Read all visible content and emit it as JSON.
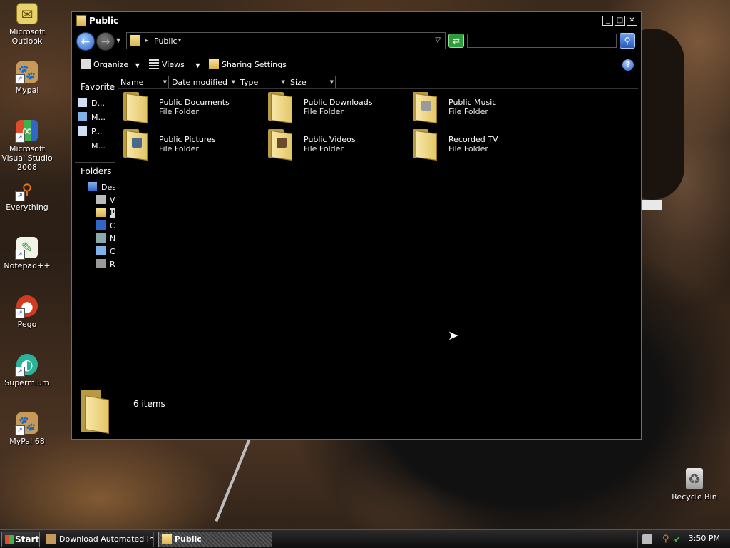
{
  "desktop": {
    "icons": [
      {
        "label": "Microsoft Outlook",
        "icon": "outlook-icon"
      },
      {
        "label": "Mypal",
        "icon": "mypal-icon"
      },
      {
        "label": "Microsoft Visual Studio 2008",
        "icon": "visual-studio-icon"
      },
      {
        "label": "Everything",
        "icon": "everything-icon"
      },
      {
        "label": "Notepad++",
        "icon": "notepadpp-icon"
      },
      {
        "label": "Pego",
        "icon": "pego-icon"
      },
      {
        "label": "Supermium",
        "icon": "supermium-icon"
      },
      {
        "label": "MyPal 68",
        "icon": "mypal-icon"
      }
    ],
    "recycle_bin": {
      "label": "Recycle Bin",
      "icon": "recycle-bin-icon"
    }
  },
  "window": {
    "title": "Public",
    "controls": {
      "minimize": "_",
      "maximize": "□",
      "close": "✕"
    },
    "address": {
      "path": "Public"
    },
    "search": {
      "placeholder": ""
    },
    "toolbar": {
      "organize": "Organize",
      "views": "Views",
      "sharing": "Sharing Settings"
    },
    "left_pane": {
      "favorites_heading": "Favorite l",
      "favorites": [
        {
          "label": "D...",
          "icon": "documents-icon"
        },
        {
          "label": "M...",
          "icon": "music-icon"
        },
        {
          "label": "P...",
          "icon": "pictures-icon"
        },
        {
          "label": "M...",
          "icon": ""
        }
      ],
      "folders_heading": "Folders",
      "tree": [
        {
          "label": "Des",
          "icon": "desktop-icon"
        },
        {
          "label": "V",
          "icon": "user-folder-icon"
        },
        {
          "label": "P",
          "icon": "folder-icon"
        },
        {
          "label": "C",
          "icon": "computer-icon"
        },
        {
          "label": "N",
          "icon": "network-icon"
        },
        {
          "label": "C",
          "icon": "control-panel-icon"
        },
        {
          "label": "R",
          "icon": "recycle-bin-icon"
        }
      ]
    },
    "columns": [
      "Name",
      "Date modified",
      "Type",
      "Size"
    ],
    "items": [
      {
        "name": "Public Documents",
        "type": "File Folder"
      },
      {
        "name": "Public Downloads",
        "type": "File Folder"
      },
      {
        "name": "Public Music",
        "type": "File Folder"
      },
      {
        "name": "Public Pictures",
        "type": "File Folder"
      },
      {
        "name": "Public Videos",
        "type": "File Folder"
      },
      {
        "name": "Recorded TV",
        "type": "File Folder"
      }
    ],
    "details": {
      "count": "6 items"
    }
  },
  "taskbar": {
    "start": "Start",
    "tasks": [
      {
        "label": "Download Automated In...",
        "active": false
      },
      {
        "label": "Public",
        "active": true
      }
    ],
    "clock": "3:50 PM"
  },
  "colors": {
    "window_bg": "#000000",
    "folder_yellow": "#e3c667",
    "accent_blue": "#2f66c8",
    "refresh_green": "#2e9c3a"
  }
}
